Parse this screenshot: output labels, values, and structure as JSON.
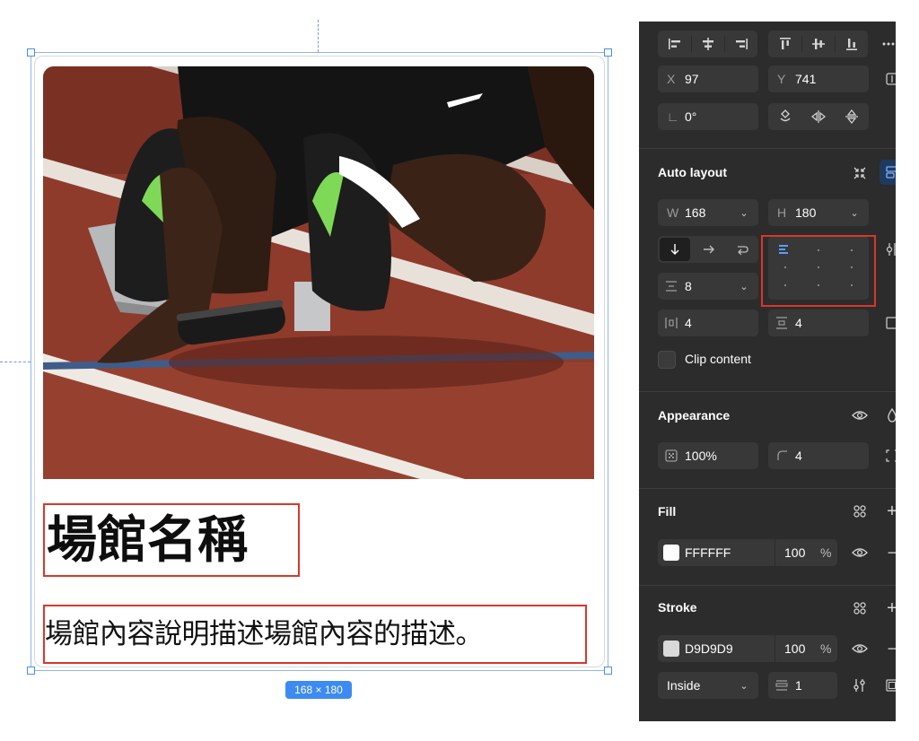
{
  "canvas": {
    "card": {
      "title": "場館名稱",
      "description": "場館內容說明描述場館內容的描述。",
      "image_alt": "runner-at-starting-blocks"
    },
    "size_badge": "168 × 180",
    "selection_color": "#d9372a",
    "guide_color": "#6a9ad8"
  },
  "panel": {
    "position": {
      "x_label": "X",
      "x_value": "97",
      "y_label": "Y",
      "y_value": "741"
    },
    "rotation": {
      "value": "0°"
    },
    "auto_layout": {
      "title": "Auto layout",
      "width_label": "W",
      "width_value": "168",
      "height_label": "H",
      "height_value": "180",
      "direction": "vertical",
      "gap": "8",
      "padding_horizontal": "4",
      "padding_vertical": "4",
      "alignment": "top-left",
      "clip_content_label": "Clip content",
      "clip_content": false
    },
    "appearance": {
      "title": "Appearance",
      "opacity": "100%",
      "corner_radius": "4"
    },
    "fill": {
      "title": "Fill",
      "color_hex": "FFFFFF",
      "opacity": "100",
      "percent": "%",
      "swatch": "#ffffff"
    },
    "stroke": {
      "title": "Stroke",
      "color_hex": "D9D9D9",
      "opacity": "100",
      "percent": "%",
      "swatch": "#d9d9d9",
      "position": "Inside",
      "weight": "1"
    },
    "colors": {
      "background": "#2c2c2c",
      "field": "#383838",
      "accent": "#4d8ef5"
    }
  }
}
